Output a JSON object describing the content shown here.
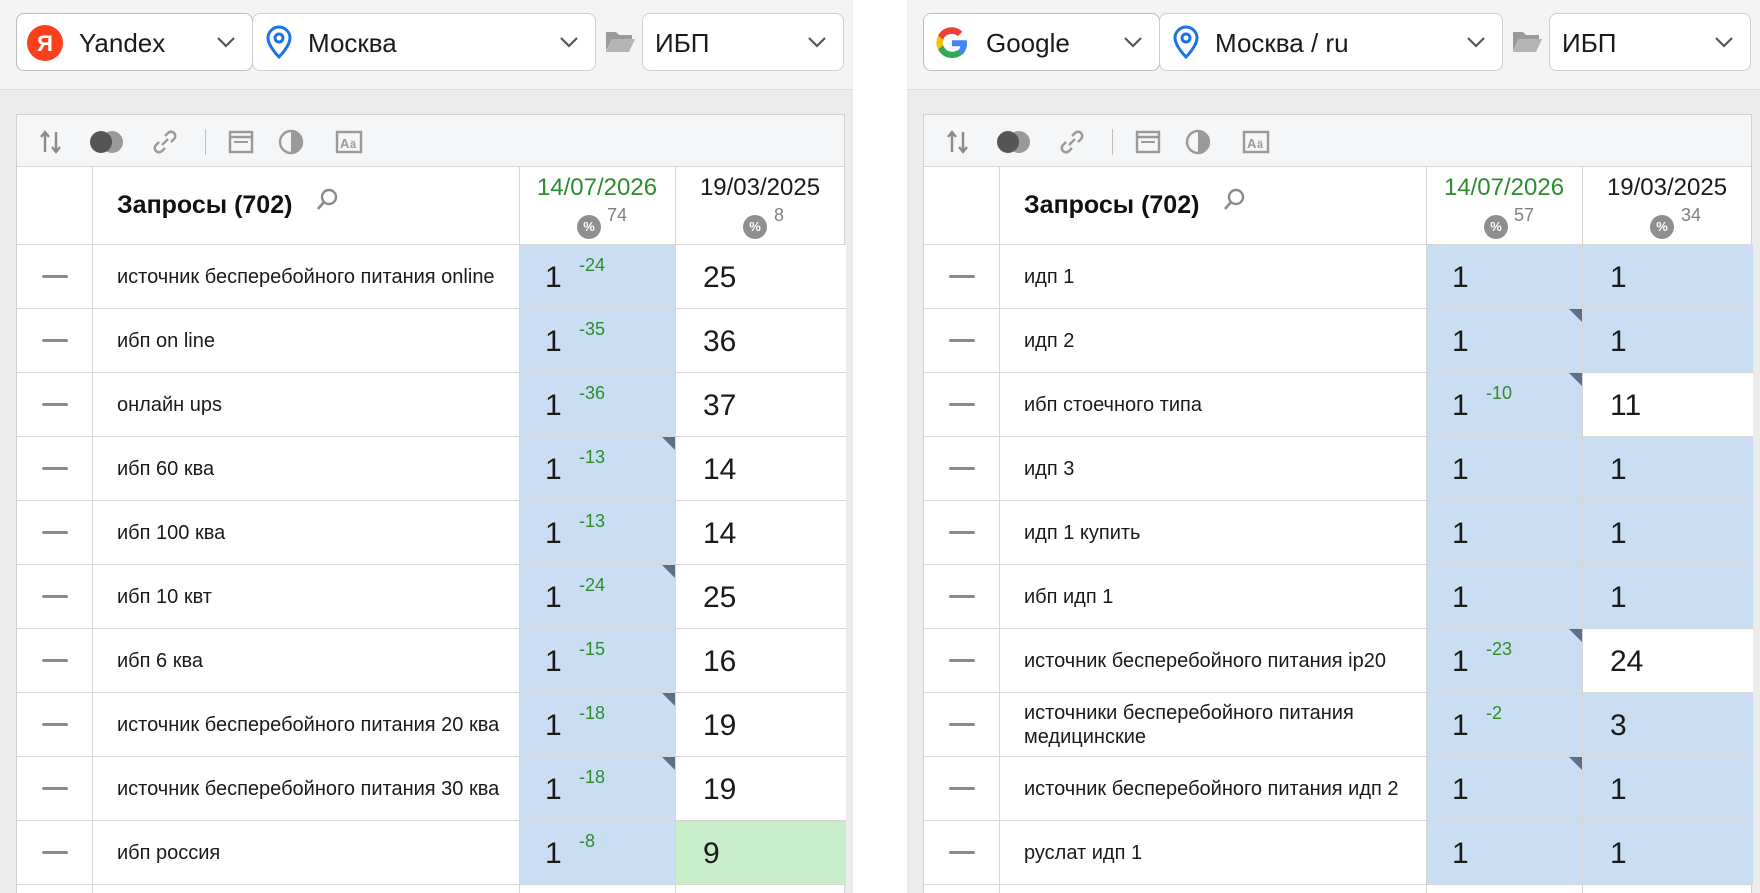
{
  "colors": {
    "position_cell": "#c9def3",
    "improved_cell": "#c8edc9",
    "delta_text": "#2e8b2e",
    "date_current": "#2e8b2e"
  },
  "toolbar_icons": [
    "sort-icon",
    "toggle-icon",
    "link-icon",
    "window-icon",
    "contrast-icon",
    "font-icon"
  ],
  "left": {
    "engine": {
      "label": "Yandex",
      "icon": "yandex-logo-icon"
    },
    "region": {
      "label": "Москва",
      "icon": "map-pin-icon"
    },
    "project": {
      "label": "ИБП",
      "icon": "folder-icon"
    },
    "header": {
      "title": "Запросы (702)",
      "date1": "14/07/2026",
      "pct1": "74",
      "date2": "19/03/2025",
      "pct2": "8",
      "pct_symbol": "%"
    },
    "rows": [
      {
        "query": "источник бесперебойного питания online",
        "pos": "1",
        "delta": "-24",
        "prev": "25",
        "prev_state": "none",
        "marker": false
      },
      {
        "query": "ибп on line",
        "pos": "1",
        "delta": "-35",
        "prev": "36",
        "prev_state": "none",
        "marker": false
      },
      {
        "query": "онлайн ups",
        "pos": "1",
        "delta": "-36",
        "prev": "37",
        "prev_state": "none",
        "marker": false
      },
      {
        "query": "ибп 60 ква",
        "pos": "1",
        "delta": "-13",
        "prev": "14",
        "prev_state": "none",
        "marker": true
      },
      {
        "query": "ибп 100 ква",
        "pos": "1",
        "delta": "-13",
        "prev": "14",
        "prev_state": "none",
        "marker": false
      },
      {
        "query": "ибп 10 квт",
        "pos": "1",
        "delta": "-24",
        "prev": "25",
        "prev_state": "none",
        "marker": true
      },
      {
        "query": "ибп 6 ква",
        "pos": "1",
        "delta": "-15",
        "prev": "16",
        "prev_state": "none",
        "marker": false
      },
      {
        "query": "источник бесперебойного питания 20 ква",
        "pos": "1",
        "delta": "-18",
        "prev": "19",
        "prev_state": "none",
        "marker": true
      },
      {
        "query": "источник бесперебойного питания 30 ква",
        "pos": "1",
        "delta": "-18",
        "prev": "19",
        "prev_state": "none",
        "marker": true
      },
      {
        "query": "ибп россия",
        "pos": "1",
        "delta": "-8",
        "prev": "9",
        "prev_state": "green",
        "marker": false
      }
    ]
  },
  "right": {
    "engine": {
      "label": "Google",
      "icon": "google-logo-icon"
    },
    "region": {
      "label": "Москва / ru",
      "icon": "map-pin-icon"
    },
    "project": {
      "label": "ИБП",
      "icon": "folder-icon"
    },
    "header": {
      "title": "Запросы (702)",
      "date1": "14/07/2026",
      "pct1": "57",
      "date2": "19/03/2025",
      "pct2": "34",
      "pct_symbol": "%"
    },
    "rows": [
      {
        "query": "идп 1",
        "pos": "1",
        "delta": "",
        "prev": "1",
        "prev_state": "blue",
        "marker": false
      },
      {
        "query": "идп 2",
        "pos": "1",
        "delta": "",
        "prev": "1",
        "prev_state": "blue",
        "marker": true
      },
      {
        "query": "ибп стоечного типа",
        "pos": "1",
        "delta": "-10",
        "prev": "11",
        "prev_state": "none",
        "marker": true
      },
      {
        "query": "идп 3",
        "pos": "1",
        "delta": "",
        "prev": "1",
        "prev_state": "blue",
        "marker": false
      },
      {
        "query": "идп 1 купить",
        "pos": "1",
        "delta": "",
        "prev": "1",
        "prev_state": "blue",
        "marker": false
      },
      {
        "query": "ибп идп 1",
        "pos": "1",
        "delta": "",
        "prev": "1",
        "prev_state": "blue",
        "marker": false
      },
      {
        "query": "источник бесперебойного питания ip20",
        "pos": "1",
        "delta": "-23",
        "prev": "24",
        "prev_state": "none",
        "marker": true
      },
      {
        "query": "источники бесперебойного питания медицинские",
        "pos": "1",
        "delta": "-2",
        "prev": "3",
        "prev_state": "blue",
        "marker": false
      },
      {
        "query": "источник бесперебойного питания идп 2",
        "pos": "1",
        "delta": "",
        "prev": "1",
        "prev_state": "blue",
        "marker": true
      },
      {
        "query": "руслат идп 1",
        "pos": "1",
        "delta": "",
        "prev": "1",
        "prev_state": "blue",
        "marker": false
      }
    ]
  }
}
